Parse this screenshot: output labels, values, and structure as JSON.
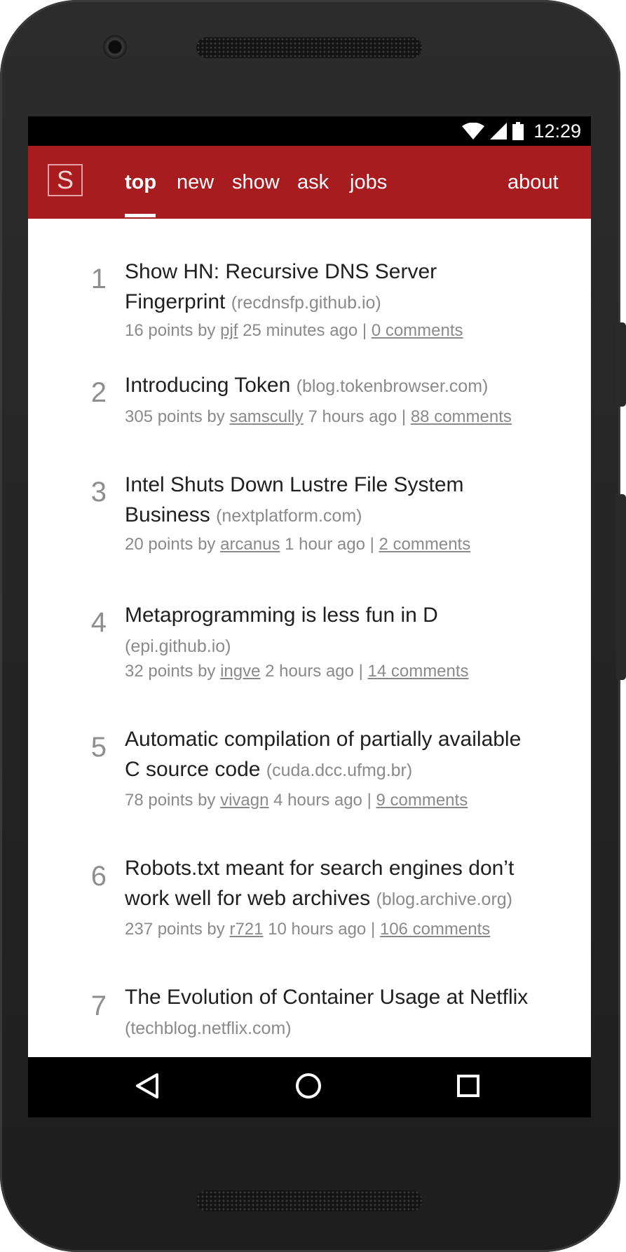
{
  "status": {
    "time": "12:29",
    "icons": [
      "wifi-icon",
      "cell-signal-icon",
      "battery-icon"
    ]
  },
  "app": {
    "logo_letter": "S",
    "accent_color": "#a81c1f"
  },
  "tabs": [
    {
      "label": "top",
      "active": true
    },
    {
      "label": "new",
      "active": false
    },
    {
      "label": "show",
      "active": false
    },
    {
      "label": "ask",
      "active": false
    },
    {
      "label": "jobs",
      "active": false
    }
  ],
  "about_label": "about",
  "stories": [
    {
      "rank": "1",
      "title_lines": [
        "Show HN: Recursive DNS Server",
        "Fingerprint"
      ],
      "domain": "(recdnsfp.github.io)",
      "points": "16 points by",
      "user": "pjf",
      "age": "25 minutes ago |",
      "comments": "0 comments"
    },
    {
      "rank": "2",
      "title_lines": [
        "Introducing Token"
      ],
      "domain": "(blog.tokenbrowser.com)",
      "points": "305 points by",
      "user": "samscully",
      "age": "7 hours ago |",
      "comments": "88 comments"
    },
    {
      "rank": "3",
      "title_lines": [
        "Intel Shuts Down Lustre File System",
        "Business"
      ],
      "domain": "(nextplatform.com)",
      "points": "20 points by",
      "user": "arcanus",
      "age": "1 hour ago |",
      "comments": "2 comments"
    },
    {
      "rank": "4",
      "title_lines": [
        "Metaprogramming is less fun in D"
      ],
      "domain": "(epi.github.io)",
      "points": "32 points by",
      "user": "ingve",
      "age": "2 hours ago |",
      "comments": "14 comments"
    },
    {
      "rank": "5",
      "title_lines": [
        "Automatic compilation of partially available",
        "C source code"
      ],
      "domain": "(cuda.dcc.ufmg.br)",
      "points": "78 points by",
      "user": "vivagn",
      "age": "4 hours ago |",
      "comments": "9 comments"
    },
    {
      "rank": "6",
      "title_lines": [
        "Robots.txt meant for search engines don’t",
        "work well for web archives"
      ],
      "domain": "(blog.archive.org)",
      "points": "237 points by",
      "user": "r721",
      "age": "10 hours ago |",
      "comments": "106 comments"
    },
    {
      "rank": "7",
      "title_lines": [
        "The Evolution of Container Usage at Netflix"
      ],
      "domain": "(techblog.netflix.com)",
      "points": "",
      "user": "",
      "age": "",
      "comments": ""
    }
  ],
  "nav": {
    "back": "back-triangle-icon",
    "home": "home-circle-icon",
    "recents": "recents-square-icon"
  }
}
